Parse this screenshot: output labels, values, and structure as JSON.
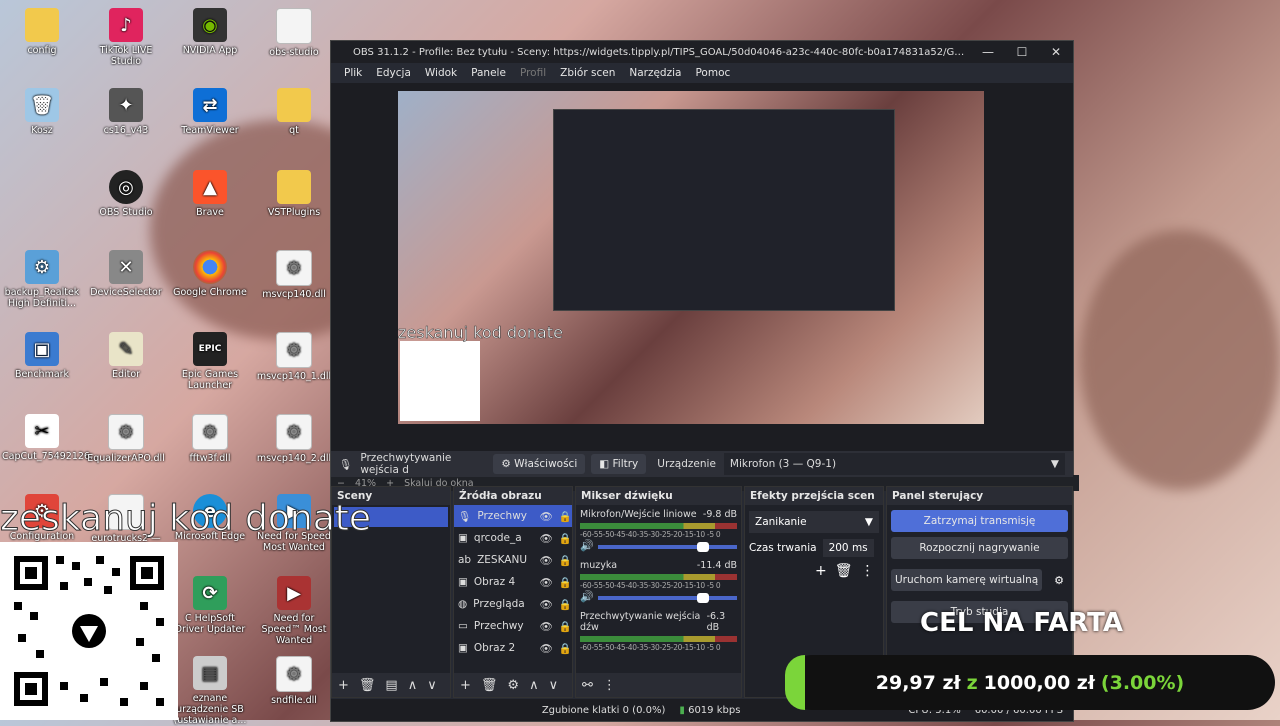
{
  "desktop": {
    "icons": [
      {
        "label": "config"
      },
      {
        "label": "TikTok LIVE Studio"
      },
      {
        "label": "NVIDIA App"
      },
      {
        "label": "obs-studio"
      },
      {
        "label": "Kosz"
      },
      {
        "label": "cs16_v43"
      },
      {
        "label": "TeamViewer"
      },
      {
        "label": "qt"
      },
      {
        "label": "OBS Studio"
      },
      {
        "label": "Brave"
      },
      {
        "label": "VSTPlugins"
      },
      {
        "label": "backup_Realtek High Definiti..."
      },
      {
        "label": "DeviceSelector"
      },
      {
        "label": "Google Chrome"
      },
      {
        "label": "msvcp140.dll"
      },
      {
        "label": "Benchmark"
      },
      {
        "label": "Editor"
      },
      {
        "label": "Epic Games Launcher"
      },
      {
        "label": "msvcp140_1.dll"
      },
      {
        "label": "CapCut_75492126..."
      },
      {
        "label": "EqualizerAPO.dll"
      },
      {
        "label": "fftw3f.dll"
      },
      {
        "label": "msvcp140_2.dll"
      },
      {
        "label": "Configuration"
      },
      {
        "label": "eurotrucks2 — sk..."
      },
      {
        "label": "Microsoft Edge"
      },
      {
        "label": "Need for Speed Most Wanted"
      },
      {
        "label": "C HelpSoft Driver Updater"
      },
      {
        "label": "Need for Speed™ Most Wanted"
      },
      {
        "label": "eznane urządzenie SB (ustawianie a..."
      },
      {
        "label": "sndfile.dll"
      }
    ]
  },
  "overlay": {
    "donate_text": "zeskanuj kod donate",
    "goal_title": "CEL NA FARTA",
    "goal_current": "29,97 zł",
    "goal_sep": "z",
    "goal_target": "1000,00 zł",
    "goal_percent": "(3.00%)"
  },
  "obs": {
    "title": "OBS 31.1.2 - Profile: Bez tytułu - Sceny: https://widgets.tipply.pl/TIPS_GOAL/50d04046-a23c-440c-80fc-b0a174831a52/GOAL/f58ce3a5-8255-4c42-8d67-b28...",
    "menu": [
      "Plik",
      "Edycja",
      "Widok",
      "Panele",
      "Profil",
      "Zbiór scen",
      "Narzędzia",
      "Pomoc"
    ],
    "zoom": "41%",
    "zoom_hint": "Skaluj do okna",
    "source_name": "Przechwytywanie wejścia d",
    "properties_label": "Właściwości",
    "filters_label": "Filtry",
    "device_label": "Urządzenie",
    "device_value": "Mikrofon (3 — Q9-1)",
    "docks": {
      "scenes": "Sceny",
      "sources": "Źródła obrazu",
      "mixer": "Mikser dźwięku",
      "transitions": "Efekty przejścia scen",
      "controls": "Panel sterujący"
    },
    "sources": [
      {
        "name": "Przechwy"
      },
      {
        "name": "qrcode_a"
      },
      {
        "name": "ZESKANU"
      },
      {
        "name": "Obraz 4"
      },
      {
        "name": "Przeglądа"
      },
      {
        "name": "Przechwy"
      },
      {
        "name": "Obraz 2"
      }
    ],
    "mixer": [
      {
        "name": "Mikrofon/Wejście liniowe",
        "db": "-9.8 dB"
      },
      {
        "name": "muzyka",
        "db": "-11.4 dB"
      },
      {
        "name": "Przechwytywanie wejścia dźw",
        "db": "-6.3 dB"
      }
    ],
    "meter_scale": "-60-55-50-45-40-35-30-25-20-15-10 -5  0",
    "transition": "Zanikanie",
    "duration_label": "Czas trwania",
    "duration_value": "200 ms",
    "controls": [
      {
        "label": "Zatrzymaj transmisję"
      },
      {
        "label": "Rozpocznij nagrywanie"
      },
      {
        "label": "Uruchom kamerę wirtualną"
      },
      {
        "label": "Tryb studia"
      }
    ],
    "status": {
      "dropped": "Zgubione klatki 0 (0.0%)",
      "bitrate": "6019 kbps",
      "cpu": "CPU: 5.1%",
      "fps": "60.00 / 60.00 FPS"
    }
  }
}
